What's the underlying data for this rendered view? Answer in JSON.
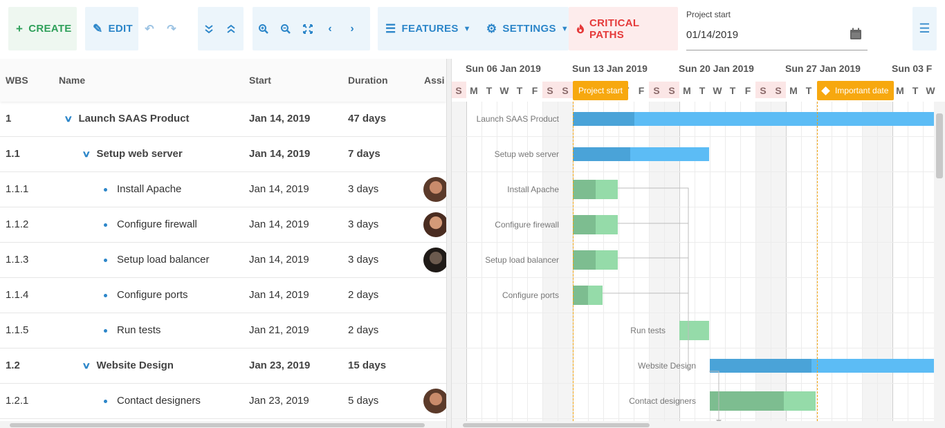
{
  "toolbar": {
    "create_label": "CREATE",
    "edit_label": "EDIT",
    "features_label": "FEATURES",
    "settings_label": "SETTINGS",
    "critical_paths_label": "CRITICAL PATHS",
    "project_start_label": "Project start",
    "project_start_value": "01/14/2019",
    "icons": [
      "plus-icon",
      "pencil-icon",
      "undo-icon",
      "redo-icon",
      "collapse-all-icon",
      "expand-all-icon",
      "zoom-in-icon",
      "zoom-out-icon",
      "zoom-fit-icon",
      "previous-icon",
      "next-icon",
      "checklist-icon",
      "gears-icon",
      "fire-icon",
      "calendar-icon",
      "hamburger-icon"
    ]
  },
  "grid": {
    "columns": [
      "WBS",
      "Name",
      "Start",
      "Duration",
      "Assi"
    ],
    "rows": [
      {
        "wbs": "1",
        "name": "Launch SAAS Product",
        "start": "Jan 14, 2019",
        "duration": "47 days",
        "level": 0,
        "parent": true,
        "avatar": false
      },
      {
        "wbs": "1.1",
        "name": "Setup web server",
        "start": "Jan 14, 2019",
        "duration": "7 days",
        "level": 1,
        "parent": true,
        "avatar": false
      },
      {
        "wbs": "1.1.1",
        "name": "Install Apache",
        "start": "Jan 14, 2019",
        "duration": "3 days",
        "level": 2,
        "parent": false,
        "avatar": true
      },
      {
        "wbs": "1.1.2",
        "name": "Configure firewall",
        "start": "Jan 14, 2019",
        "duration": "3 days",
        "level": 2,
        "parent": false,
        "avatar": true
      },
      {
        "wbs": "1.1.3",
        "name": "Setup load balancer",
        "start": "Jan 14, 2019",
        "duration": "3 days",
        "level": 2,
        "parent": false,
        "avatar": true
      },
      {
        "wbs": "1.1.4",
        "name": "Configure ports",
        "start": "Jan 14, 2019",
        "duration": "2 days",
        "level": 2,
        "parent": false,
        "avatar": false
      },
      {
        "wbs": "1.1.5",
        "name": "Run tests",
        "start": "Jan 21, 2019",
        "duration": "2 days",
        "level": 2,
        "parent": false,
        "avatar": false
      },
      {
        "wbs": "1.2",
        "name": "Website Design",
        "start": "Jan 23, 2019",
        "duration": "15 days",
        "level": 1,
        "parent": true,
        "avatar": false
      },
      {
        "wbs": "1.2.1",
        "name": "Contact designers",
        "start": "Jan 23, 2019",
        "duration": "5 days",
        "level": 2,
        "parent": false,
        "avatar": true
      }
    ]
  },
  "timeline": {
    "weeks": [
      "Sun 06 Jan 2019",
      "Sun 13 Jan 2019",
      "Sun 20 Jan 2019",
      "Sun 27 Jan 2019",
      "Sun 03 F"
    ],
    "days": [
      "S",
      "M",
      "T",
      "W",
      "T",
      "F",
      "S",
      "S",
      "M",
      "T",
      "W",
      "T",
      "F",
      "S",
      "S",
      "M",
      "T",
      "W",
      "T",
      "F",
      "S",
      "S",
      "M",
      "T",
      "W",
      "T",
      "F",
      "S",
      "S",
      "M",
      "T",
      "W"
    ],
    "markers": [
      {
        "label": "Project start"
      },
      {
        "label": "Important date"
      }
    ]
  },
  "tasks": [
    {
      "name": "Launch SAAS Product",
      "type": "parent",
      "percent_done": 17
    },
    {
      "name": "Setup web server",
      "type": "parent",
      "percent_done": 42
    },
    {
      "name": "Install Apache",
      "type": "task",
      "percent_done": 50
    },
    {
      "name": "Configure firewall",
      "type": "task",
      "percent_done": 50
    },
    {
      "name": "Setup load balancer",
      "type": "task",
      "percent_done": 50
    },
    {
      "name": "Configure ports",
      "type": "task",
      "percent_done": 50
    },
    {
      "name": "Run tests",
      "type": "task",
      "percent_done": 0
    },
    {
      "name": "Website Design",
      "type": "parent",
      "percent_done": 45
    },
    {
      "name": "Contact designers",
      "type": "task",
      "percent_done": 70
    }
  ],
  "colors": {
    "accent": "#2c86c9",
    "create": "#2fa05a",
    "critical": "#e53a3a",
    "marker": "#f7a80f",
    "parent_bar": "#5cbcf5",
    "task_bar": "#95dba9"
  }
}
